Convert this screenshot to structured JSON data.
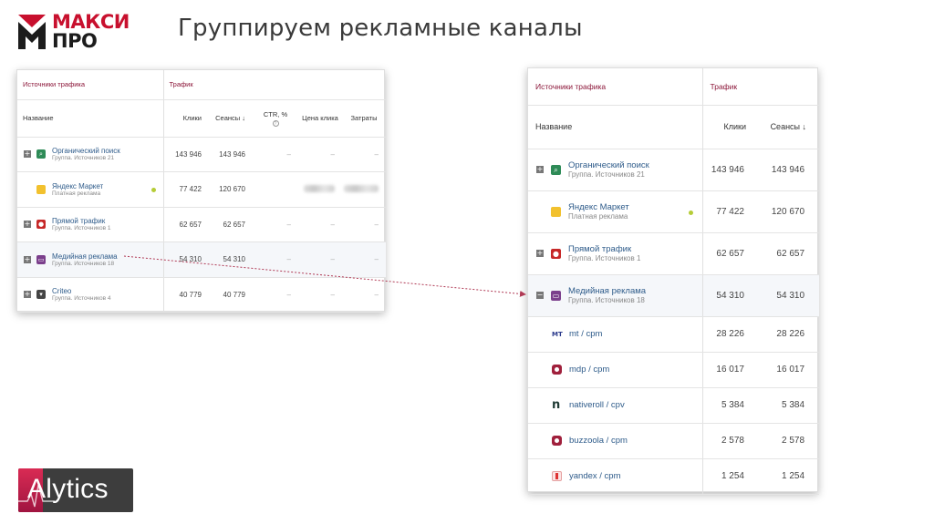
{
  "logo": {
    "line1": "МАКСИ",
    "line2": "ПРО"
  },
  "slide": {
    "title": "Группируем рекламные каналы"
  },
  "left_table": {
    "section_sources": "Источники трафика",
    "section_traffic": "Трафик",
    "col_name": "Название",
    "col_clicks": "Клики",
    "col_sessions": "Сеансы ↓",
    "col_ctr": "CTR, %",
    "col_cpc": "Цена клика",
    "col_cost": "Затраты",
    "rows": [
      {
        "name": "Органический поиск",
        "sub": "Группа. Источников 21",
        "clicks": "143 946",
        "sessions": "143 946",
        "ctr": "–",
        "cpc": "–",
        "cost": "–"
      },
      {
        "name": "Яндекс Маркет",
        "sub": "Платная реклама",
        "clicks": "77 422",
        "sessions": "120 670"
      },
      {
        "name": "Прямой трафик",
        "sub": "Группа. Источников 1",
        "clicks": "62 657",
        "sessions": "62 657",
        "ctr": "–",
        "cpc": "–",
        "cost": "–"
      },
      {
        "name": "Медийная реклама",
        "sub": "Группа. Источников 18",
        "clicks": "54 310",
        "sessions": "54 310",
        "ctr": "–",
        "cpc": "–",
        "cost": "–"
      },
      {
        "name": "Criteo",
        "sub": "Группа. Источников 4",
        "clicks": "40 779",
        "sessions": "40 779",
        "ctr": "–",
        "cpc": "–",
        "cost": "–"
      }
    ]
  },
  "right_table": {
    "section_sources": "Источники трафика",
    "section_traffic": "Трафик",
    "col_name": "Название",
    "col_clicks": "Клики",
    "col_sessions": "Сеансы ↓",
    "rows": [
      {
        "name": "Органический поиск",
        "sub": "Группа. Источников 21",
        "clicks": "143 946",
        "sessions": "143 946"
      },
      {
        "name": "Яндекс Маркет",
        "sub": "Платная реклама",
        "clicks": "77 422",
        "sessions": "120 670"
      },
      {
        "name": "Прямой трафик",
        "sub": "Группа. Источников 1",
        "clicks": "62 657",
        "sessions": "62 657"
      },
      {
        "name": "Медийная реклама",
        "sub": "Группа. Источников 18",
        "clicks": "54 310",
        "sessions": "54 310"
      }
    ],
    "children": [
      {
        "icon_label": "MT",
        "name": "mt / cpm",
        "clicks": "28 226",
        "sessions": "28 226"
      },
      {
        "name": "mdp / cpm",
        "clicks": "16 017",
        "sessions": "16 017"
      },
      {
        "icon_label": "n",
        "name": "nativeroll / cpv",
        "clicks": "5 384",
        "sessions": "5 384"
      },
      {
        "name": "buzzoola / cpm",
        "clicks": "2 578",
        "sessions": "2 578"
      },
      {
        "name": "yandex / cpm",
        "clicks": "1 254",
        "sessions": "1 254"
      }
    ]
  },
  "alytics": {
    "text": "Alytics"
  },
  "colors": {
    "brand_red": "#c8102e",
    "section_header": "#8b1538",
    "link_blue": "#2e5b8a",
    "status_dot": "#b5cc37",
    "icon_organic": "#2e8b57",
    "icon_market": "#f2c12e",
    "icon_direct": "#c62828",
    "icon_media": "#7b3f8c",
    "icon_criteo": "#444444"
  }
}
